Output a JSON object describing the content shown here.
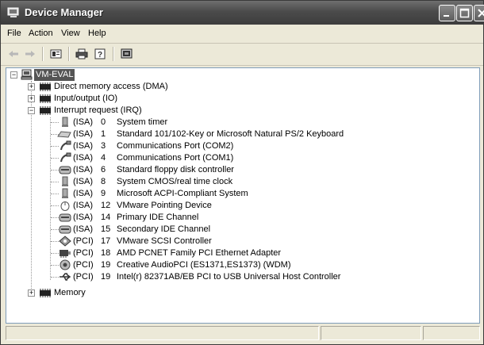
{
  "window": {
    "title": "Device Manager"
  },
  "menu": [
    "File",
    "Action",
    "View",
    "Help"
  ],
  "toolbar": {
    "buttons": [
      "back-icon",
      "forward-icon",
      "properties-icon",
      "print-icon",
      "help-icon",
      "scan-hardware-icon"
    ]
  },
  "tree": {
    "root": "VM-EVAL",
    "categories": [
      {
        "label": "Direct memory access (DMA)",
        "expanded": false
      },
      {
        "label": "Input/output (IO)",
        "expanded": false
      },
      {
        "label": "Interrupt request (IRQ)",
        "expanded": true
      },
      {
        "label": "Memory",
        "expanded": false
      }
    ],
    "irq": [
      {
        "bus": "(ISA)",
        "num": "0",
        "desc": "System timer",
        "icon": "system-device-icon"
      },
      {
        "bus": "(ISA)",
        "num": "1",
        "desc": "Standard 101/102-Key or Microsoft Natural PS/2 Keyboard",
        "icon": "keyboard-icon"
      },
      {
        "bus": "(ISA)",
        "num": "3",
        "desc": "Communications Port (COM2)",
        "icon": "port-icon"
      },
      {
        "bus": "(ISA)",
        "num": "4",
        "desc": "Communications Port (COM1)",
        "icon": "port-icon"
      },
      {
        "bus": "(ISA)",
        "num": "6",
        "desc": "Standard floppy disk controller",
        "icon": "floppy-controller-icon"
      },
      {
        "bus": "(ISA)",
        "num": "8",
        "desc": "System CMOS/real time clock",
        "icon": "system-device-icon"
      },
      {
        "bus": "(ISA)",
        "num": "9",
        "desc": "Microsoft ACPI-Compliant System",
        "icon": "system-device-icon"
      },
      {
        "bus": "(ISA)",
        "num": "12",
        "desc": "VMware Pointing Device",
        "icon": "mouse-icon"
      },
      {
        "bus": "(ISA)",
        "num": "14",
        "desc": "Primary IDE Channel",
        "icon": "ide-controller-icon"
      },
      {
        "bus": "(ISA)",
        "num": "15",
        "desc": "Secondary IDE Channel",
        "icon": "ide-controller-icon"
      },
      {
        "bus": "(PCI)",
        "num": "17",
        "desc": "VMware SCSI Controller",
        "icon": "scsi-icon"
      },
      {
        "bus": "(PCI)",
        "num": "18",
        "desc": "AMD PCNET Family PCI Ethernet Adapter",
        "icon": "network-adapter-icon"
      },
      {
        "bus": "(PCI)",
        "num": "19",
        "desc": "Creative AudioPCI (ES1371,ES1373) (WDM)",
        "icon": "sound-icon"
      },
      {
        "bus": "(PCI)",
        "num": "19",
        "desc": "Intel(r) 82371AB/EB PCI to USB Universal Host Controller",
        "icon": "usb-icon"
      }
    ]
  }
}
